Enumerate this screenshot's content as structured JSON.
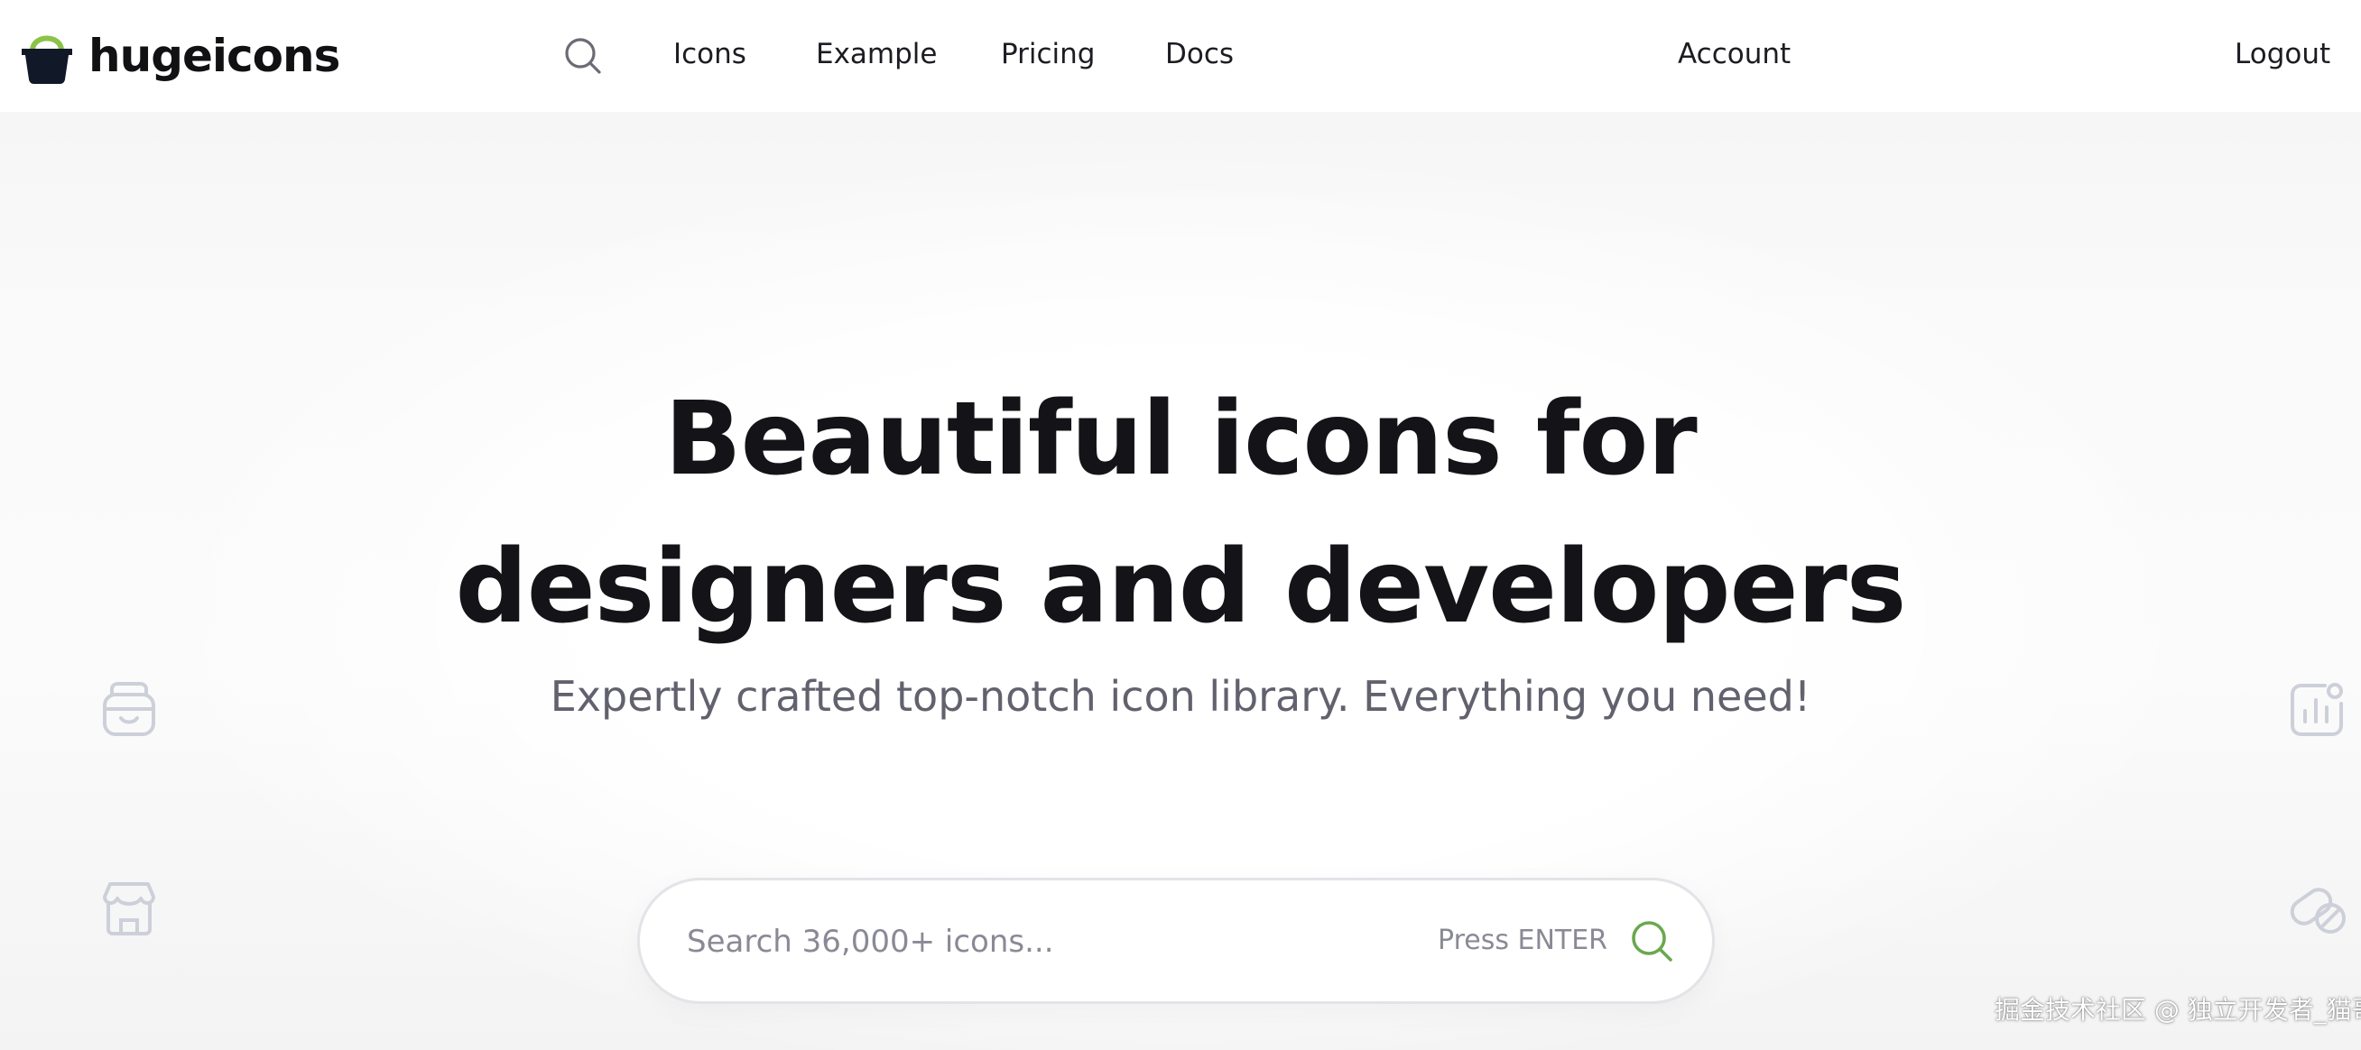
{
  "brand": {
    "name": "hugeicons",
    "accent_color": "#8bc34a",
    "mark_color": "#111827"
  },
  "nav": {
    "search_icon": "search-icon",
    "links": {
      "icons": "Icons",
      "example": "Example",
      "pricing": "Pricing",
      "docs": "Docs",
      "account": "Account",
      "logout": "Logout"
    }
  },
  "hero": {
    "headline_line1": "Beautiful icons for",
    "headline_line2": "designers and developers",
    "subtitle": "Expertly crafted top-notch icon library. Everything you need!",
    "search": {
      "placeholder": "Search 36,000+ icons...",
      "value": "",
      "hint": "Press ENTER",
      "submit_icon": "search-icon",
      "icon_color": "#6aa84f"
    },
    "decorative_icons": [
      "inbox-icon",
      "store-icon",
      "chart-icon",
      "pill-icon"
    ]
  },
  "watermark": "掘金技术社区 @ 独立开发者_猫哥"
}
